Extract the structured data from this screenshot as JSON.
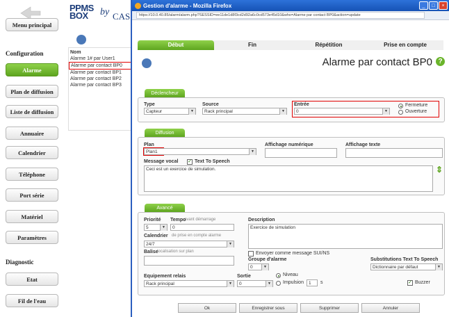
{
  "sidebar": {
    "menu_principal": "Menu principal",
    "configuration": "Configuration",
    "items": [
      "Alarme",
      "Plan de diffusion",
      "Liste de diffusion",
      "Annuaire",
      "Calendrier",
      "Téléphone",
      "Port série",
      "Matériel",
      "Paramètres"
    ],
    "diagnostic": "Diagnostic",
    "diag_items": [
      "Etat",
      "Fil de l'eau"
    ]
  },
  "ppms": {
    "logo_top": "PPMS",
    "logo_bottom": "BOX",
    "by": "by",
    "cas": "CAS",
    "list_header": "Nom",
    "list_items": [
      "Alarme 1# par User1",
      "Alarme par contact BP0",
      "Alarme par contact BP1",
      "Alarme par contact BP2",
      "Alarme par contact BP3"
    ]
  },
  "window": {
    "title": "Gestion d'alarme - Mozilla Firefox",
    "url": "https://10.0.40.85/alarm/alarm.php?SESSID=ee11de1d8f3cd2d92a6c0cd573e45d10&who=Alarme par contact BP0&action=update",
    "controls": [
      "_",
      "□",
      "×"
    ]
  },
  "tabs": [
    "Début",
    "Fin",
    "Répétition",
    "Prise en compte"
  ],
  "page_title": "Alarme par contact BP0",
  "help": "?",
  "declencheur": {
    "tab": "Déclencheur",
    "type_label": "Type",
    "type_value": "Capteur",
    "source_label": "Source",
    "source_value": "Rack principal",
    "entree_label": "Entrée",
    "entree_value": "0",
    "radio_fermeture": "Fermeture",
    "radio_ouverture": "Ouverture"
  },
  "diffusion": {
    "tab": "Diffusion",
    "plan_label": "Plan",
    "plan_value": "Plan1",
    "affichage_num_label": "Affichage numérique",
    "affichage_txt_label": "Affichage texte",
    "message_label": "Message vocal",
    "tts_label": "Text To Speech",
    "message_value": "Ceci est un exercice de simulation."
  },
  "avance": {
    "tab": "Avancé",
    "priorite_label": "Priorité",
    "priorite_value": "5",
    "tempo_label": "Tempo",
    "tempo_hint": "avant démarrage",
    "tempo_value": "0",
    "description_label": "Description",
    "description_value": "Exercice de simulation",
    "calendrier_label": "Calendrier",
    "calendrier_hint": "de prise en compte alarme",
    "calendrier_value": "24/7",
    "balise_label": "Balise",
    "balise_hint": "localisation sur plan",
    "sms_label": "Envoyer comme message SUI/NS",
    "groupe_label": "Groupe d'alarme",
    "groupe_value": "0",
    "subst_label": "Substitutions Text To Speech",
    "subst_value": "Dictionnaire par défaut",
    "relais_label": "Equipement relais",
    "relais_value": "Rack principal",
    "sortie_label": "Sortie",
    "sortie_value": "0",
    "niveau_label": "Niveau",
    "impulsion_label": "Impulsion",
    "impulsion_value": "1",
    "impulsion_unit": "s",
    "buzzer_label": "Buzzer"
  },
  "buttons": [
    "Ok",
    "Enregistrer sous",
    "Supprimer",
    "Annuler"
  ]
}
